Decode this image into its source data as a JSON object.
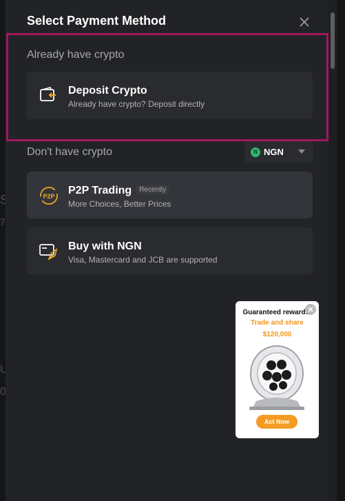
{
  "modal": {
    "title": "Select Payment Method"
  },
  "already_section": {
    "label": "Already have crypto",
    "deposit_title": "Deposit Crypto",
    "deposit_subtitle": "Already have crypto? Deposit directly"
  },
  "no_crypto_section": {
    "label": "Don't have crypto",
    "currency": "NGN",
    "currency_coin": "N"
  },
  "options": [
    {
      "title": "P2P Trading",
      "badge": "Recently",
      "subtitle": "More Choices, Better Prices",
      "icon": "p2p-icon"
    },
    {
      "title": "Buy with NGN",
      "subtitle": "Visa, Mastercard and JCB are supported",
      "icon": "card-rocket-icon"
    }
  ],
  "promo": {
    "headline": "Guaranteed rewards!",
    "subline": "Trade and share",
    "amount": "$120,000",
    "cta": "Act Now"
  },
  "colors": {
    "panel": "#222326",
    "card": "#2a2b2e",
    "accent_highlight": "#a0195f",
    "promo_orange": "#f59b23",
    "coin_green": "#2bb673"
  }
}
